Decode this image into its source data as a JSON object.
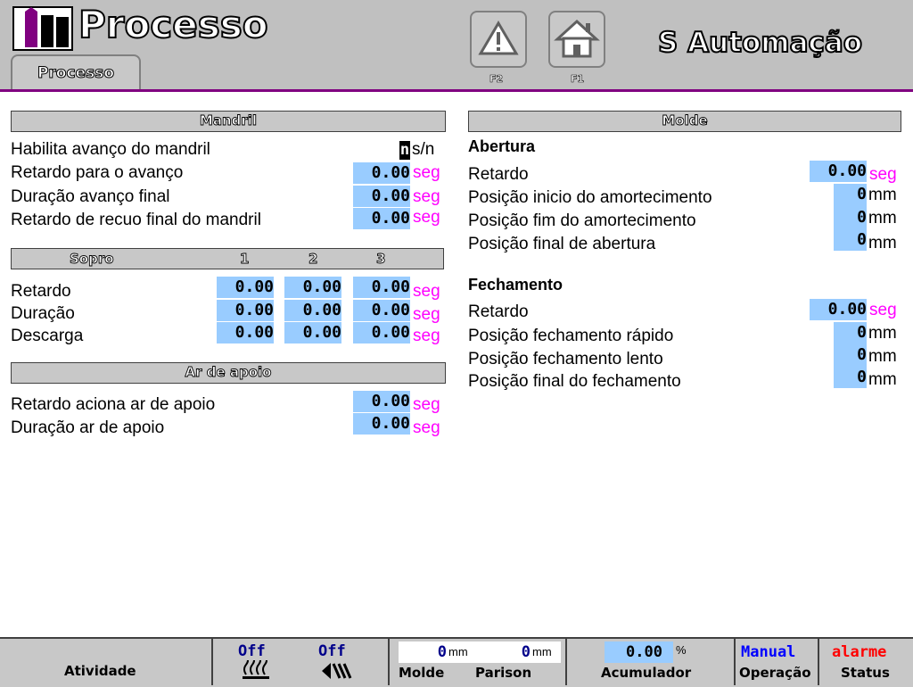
{
  "header": {
    "title": "Processo",
    "brand": "S Automação",
    "tab_label": "Processo",
    "fkeys": [
      {
        "label": "F2",
        "icon": "warning-icon"
      },
      {
        "label": "F1",
        "icon": "home-icon"
      }
    ]
  },
  "mandril": {
    "title": "Mandril",
    "habilita": {
      "label": "Habilita avanço do mandril",
      "value": "n",
      "unit": "s/n"
    },
    "rows": [
      {
        "label": "Retardo para o avanço",
        "value": "0.00",
        "unit": "seg"
      },
      {
        "label": "Duração avanço final",
        "value": "0.00",
        "unit": "seg"
      },
      {
        "label": "Retardo de recuo final do mandril",
        "value": "0.00",
        "unit": "seg"
      }
    ]
  },
  "sopro": {
    "title": "Sopro",
    "cols": [
      "1",
      "2",
      "3"
    ],
    "unit": "seg",
    "rows": [
      {
        "label": "Retardo",
        "values": [
          "0.00",
          "0.00",
          "0.00"
        ]
      },
      {
        "label": "Duração",
        "values": [
          "0.00",
          "0.00",
          "0.00"
        ]
      },
      {
        "label": "Descarga",
        "values": [
          "0.00",
          "0.00",
          "0.00"
        ]
      }
    ]
  },
  "ar_apoio": {
    "title": "Ar de apoio",
    "rows": [
      {
        "label": "Retardo aciona ar de apoio",
        "value": "0.00",
        "unit": "seg"
      },
      {
        "label": "Duração ar de apoio",
        "value": "0.00",
        "unit": "seg"
      }
    ]
  },
  "molde": {
    "title": "Molde",
    "abertura": {
      "title": "Abertura",
      "retardo": {
        "label": "Retardo",
        "value": "0.00",
        "unit": "seg"
      },
      "rows": [
        {
          "label": "Posição inicio do amortecimento",
          "value": "0",
          "unit": "mm"
        },
        {
          "label": "Posição fim do amortecimento",
          "value": "0",
          "unit": "mm"
        },
        {
          "label": "Posição final de abertura",
          "value": "0",
          "unit": "mm"
        }
      ]
    },
    "fechamento": {
      "title": "Fechamento",
      "retardo": {
        "label": "Retardo",
        "value": "0.00",
        "unit": "seg"
      },
      "rows": [
        {
          "label": "Posição fechamento rápido",
          "value": "0",
          "unit": "mm"
        },
        {
          "label": "Posição fechamento lento",
          "value": "0",
          "unit": "mm"
        },
        {
          "label": "Posição final do fechamento",
          "value": "0",
          "unit": "mm"
        }
      ]
    }
  },
  "footer": {
    "atividade": "Atividade",
    "off1": "Off",
    "off2": "Off",
    "molde_value": "0",
    "molde_unit": "mm",
    "molde_label": "Molde",
    "parison_value": "0",
    "parison_unit": "mm",
    "parison_label": "Parison",
    "acum_value": "0.00",
    "acum_unit": "%",
    "acum_label": "Acumulador",
    "operacao_value": "Manual",
    "operacao_label": "Operação",
    "status_value": "alarme",
    "status_label": "Status"
  },
  "colors": {
    "accent": "#800080",
    "field": "#99ccff",
    "unit_seg": "#ff00ff",
    "alarm": "#ff0000",
    "manual": "#0000ff"
  }
}
